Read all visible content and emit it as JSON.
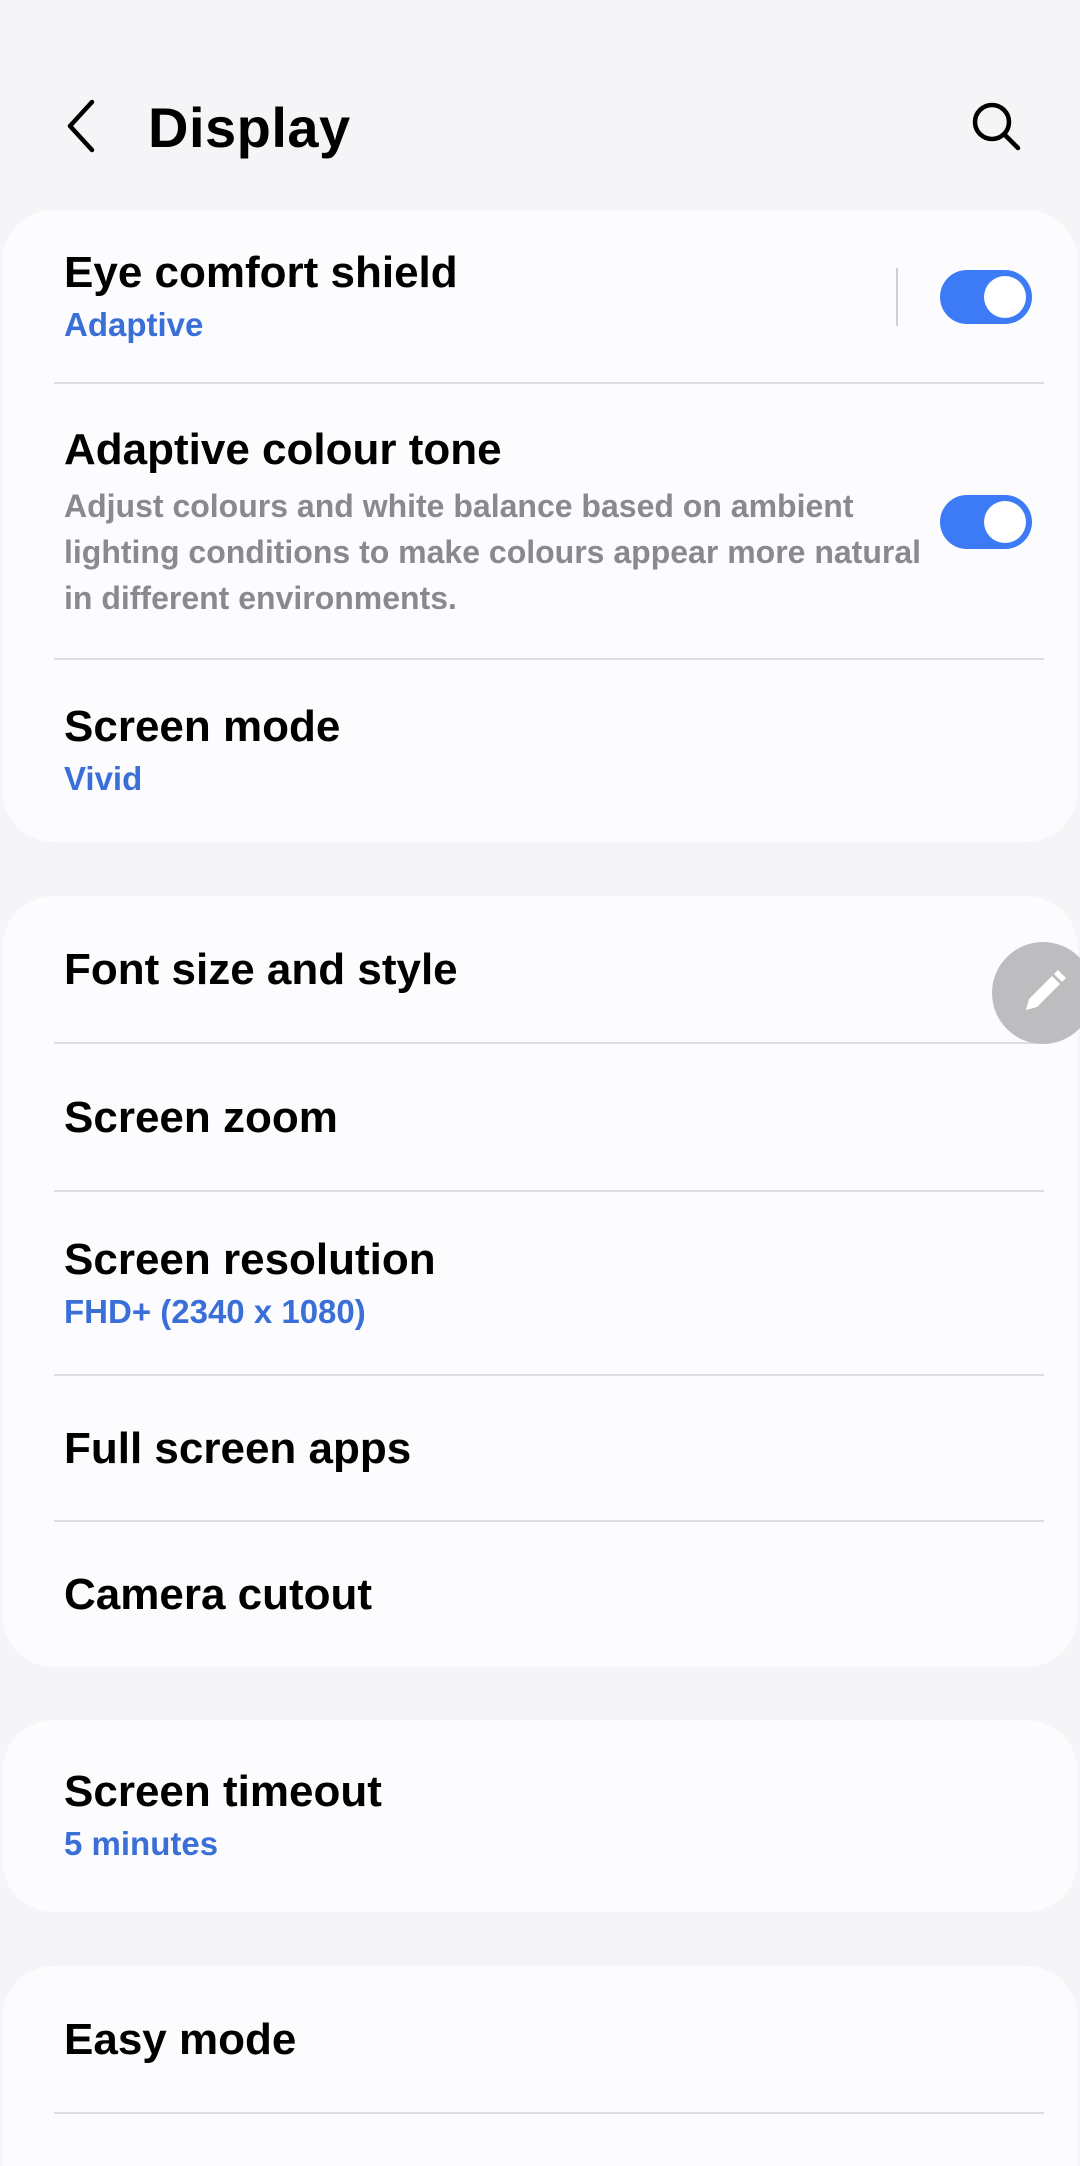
{
  "header": {
    "title": "Display"
  },
  "sections": {
    "display_main": {
      "eye_comfort": {
        "title": "Eye comfort shield",
        "subtitle": "Adaptive",
        "toggle_on": true
      },
      "adaptive_colour": {
        "title": "Adaptive colour tone",
        "description": "Adjust colours and white balance based on ambient lighting conditions to make colours appear more natural in different environments.",
        "toggle_on": true
      },
      "screen_mode": {
        "title": "Screen mode",
        "subtitle": "Vivid"
      }
    },
    "text_screen": {
      "font_size": {
        "title": "Font size and style"
      },
      "screen_zoom": {
        "title": "Screen zoom"
      },
      "screen_resolution": {
        "title": "Screen resolution",
        "subtitle": "FHD+ (2340 x 1080)"
      },
      "full_screen_apps": {
        "title": "Full screen apps"
      },
      "camera_cutout": {
        "title": "Camera cutout"
      }
    },
    "timeout": {
      "screen_timeout": {
        "title": "Screen timeout",
        "subtitle": "5 minutes"
      }
    },
    "easy": {
      "easy_mode": {
        "title": "Easy mode"
      }
    }
  },
  "icons": {
    "back": "back-arrow-icon",
    "search": "search-icon",
    "edit": "pencil-icon"
  },
  "colors": {
    "accent": "#3a6fd8",
    "toggle_on": "#3d7bf6",
    "background": "#f5f5f7",
    "card": "#fcfcfe",
    "secondary_text": "#8a8a8e"
  }
}
